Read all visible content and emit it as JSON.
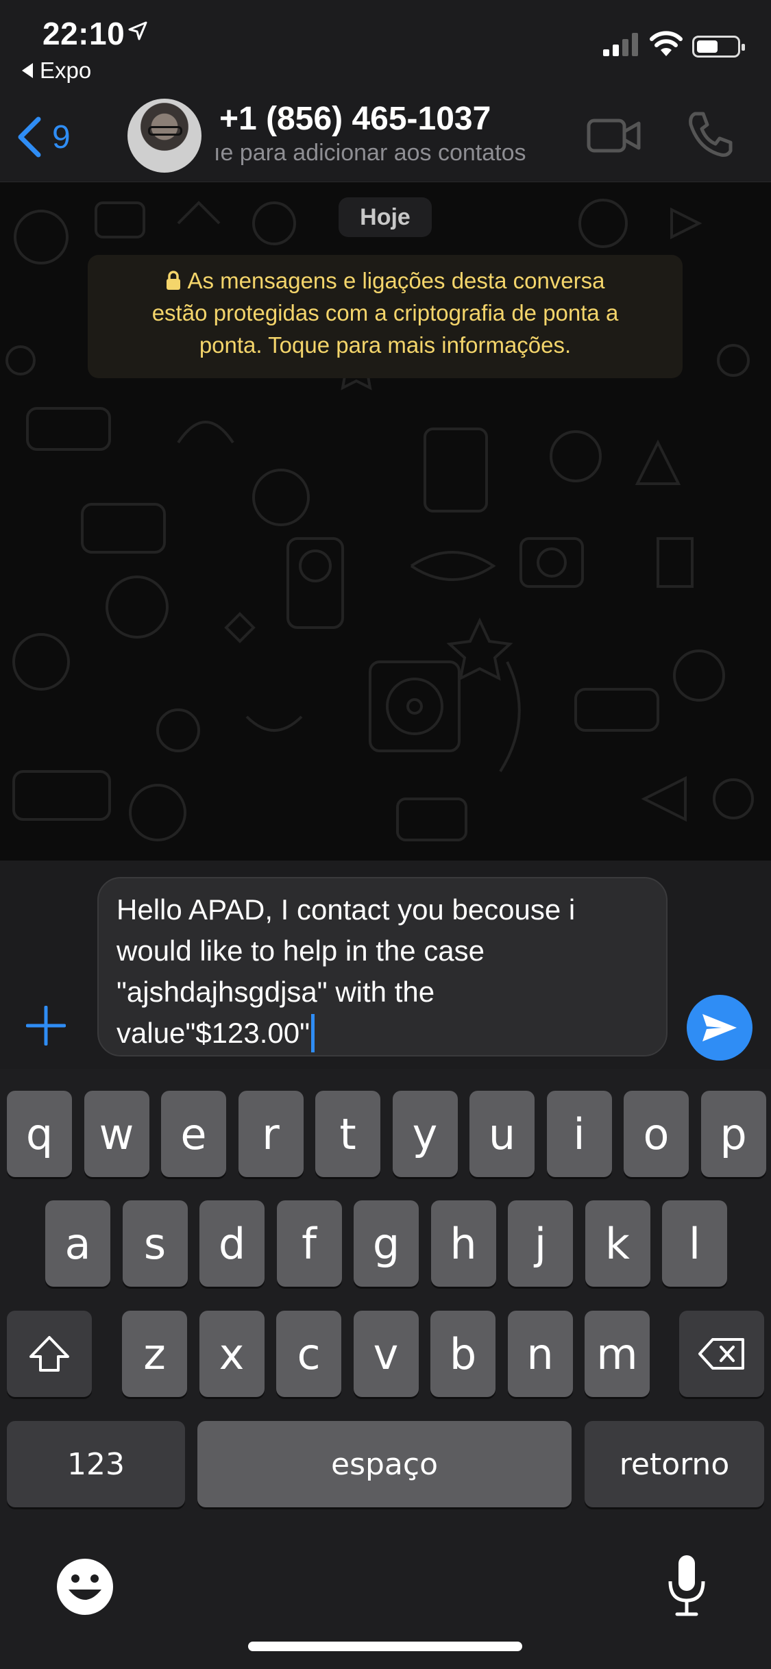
{
  "status_bar": {
    "time": "22:10",
    "back_app": "Expo"
  },
  "header": {
    "back_count": "9",
    "contact_name": "+1 (856) 465-1037",
    "contact_subtitle": "ıe para adicionar aos contatos",
    "accent_color": "#2f8df5"
  },
  "chat": {
    "day_label": "Hoje",
    "encryption_notice_lines": [
      "As mensagens e ligações desta conversa",
      "estão protegidas com a criptografia de ponta a",
      "ponta. Toque para mais informações."
    ],
    "notice_color": "#f4d56b"
  },
  "composer": {
    "text": "Hello APAD, I contact you becouse i\nwould like to help in the case\n\"ajshdajhsgdjsa\" with the\nvalue\"$123.00\""
  },
  "keyboard": {
    "row1": [
      "q",
      "w",
      "e",
      "r",
      "t",
      "y",
      "u",
      "i",
      "o",
      "p"
    ],
    "row2": [
      "a",
      "s",
      "d",
      "f",
      "g",
      "h",
      "j",
      "k",
      "l"
    ],
    "row3": [
      "z",
      "x",
      "c",
      "v",
      "b",
      "n",
      "m"
    ],
    "numbers_label": "123",
    "space_label": "espaço",
    "return_label": "retorno"
  }
}
